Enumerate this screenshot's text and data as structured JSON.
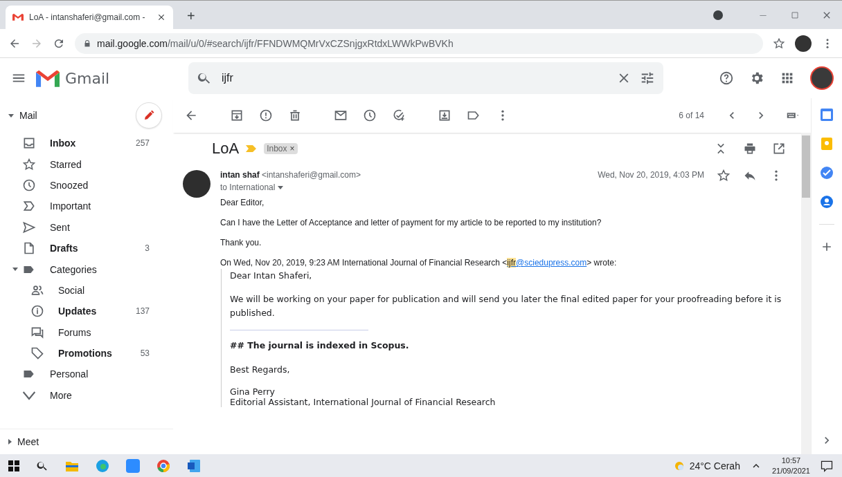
{
  "browser": {
    "tab": {
      "title": "LoA - intanshaferi@gmail.com -",
      "selected": true
    },
    "new_tab": "+",
    "address": {
      "host": "mail.google.com",
      "path": "/mail/u/0/#search/ijfr/FFNDWMQMrVxCZSnjgxRtdxLWWkPwBVKh"
    }
  },
  "header": {
    "app_name": "Gmail",
    "search": {
      "value": "ijfr"
    }
  },
  "sidebar": {
    "mail": {
      "label": "Mail",
      "expanded": true
    },
    "items": [
      {
        "label": "Inbox",
        "count": "257",
        "unread": true,
        "selected": false
      },
      {
        "label": "Starred",
        "unread": false,
        "selected": false
      },
      {
        "label": "Snoozed",
        "unread": false,
        "selected": false
      },
      {
        "label": "Important",
        "unread": false,
        "selected": false
      },
      {
        "label": "Sent",
        "unread": false,
        "selected": false
      },
      {
        "label": "Drafts",
        "count": "3",
        "unread": true,
        "selected": false
      },
      {
        "label": "Categories",
        "unread": false,
        "selected": false,
        "expanded": true,
        "children": [
          {
            "label": "Social",
            "unread": false,
            "selected": false
          },
          {
            "label": "Updates",
            "count": "137",
            "unread": true,
            "selected": false
          },
          {
            "label": "Forums",
            "unread": false,
            "selected": false
          },
          {
            "label": "Promotions",
            "count": "53",
            "unread": true,
            "selected": false
          }
        ]
      },
      {
        "label": "Personal",
        "unread": false,
        "selected": false
      },
      {
        "label": "More",
        "unread": false,
        "selected": false
      }
    ],
    "meet": {
      "label": "Meet",
      "expanded": false
    }
  },
  "toolbar": {
    "counter": "6 of 14"
  },
  "thread": {
    "subject": "LoA",
    "label_chip": "Inbox",
    "label_chip_close": "×",
    "message": {
      "sender": "intan shaf",
      "email": "<intanshaferi@gmail.com>",
      "to": "to International",
      "date": "Wed, Nov 20, 2019, 4:03 PM",
      "paragraphs": [
        "Dear Editor,",
        "Can I have the Letter of Acceptance and letter of payment for my article to be reported to my institution?",
        "Thank you."
      ],
      "quote_header": {
        "before": "On Wed, Nov 20, 2019, 9:23 AM International Journal of Financial Research <",
        "link_highlight": "ijfr",
        "link_rest": "@sciedupress.com",
        "after": "> wrote:"
      },
      "quote": [
        {
          "kind": "text",
          "text": "Dear Intan Shaferi,"
        },
        {
          "kind": "text",
          "text": "We will be working on your paper for publication and will send you later the final edited paper for your proofreading before it is published."
        },
        {
          "kind": "rule"
        },
        {
          "kind": "heading",
          "text": "## The journal is indexed in Scopus."
        },
        {
          "kind": "text",
          "text": "Best Regards,"
        },
        {
          "kind": "lines",
          "lines": [
            "Gina Perry",
            "Editorial Assistant, International Journal of Financial Research"
          ]
        }
      ]
    }
  },
  "taskbar": {
    "weather": "24°C Cerah",
    "time": "10:57",
    "date": "21/09/2021"
  }
}
